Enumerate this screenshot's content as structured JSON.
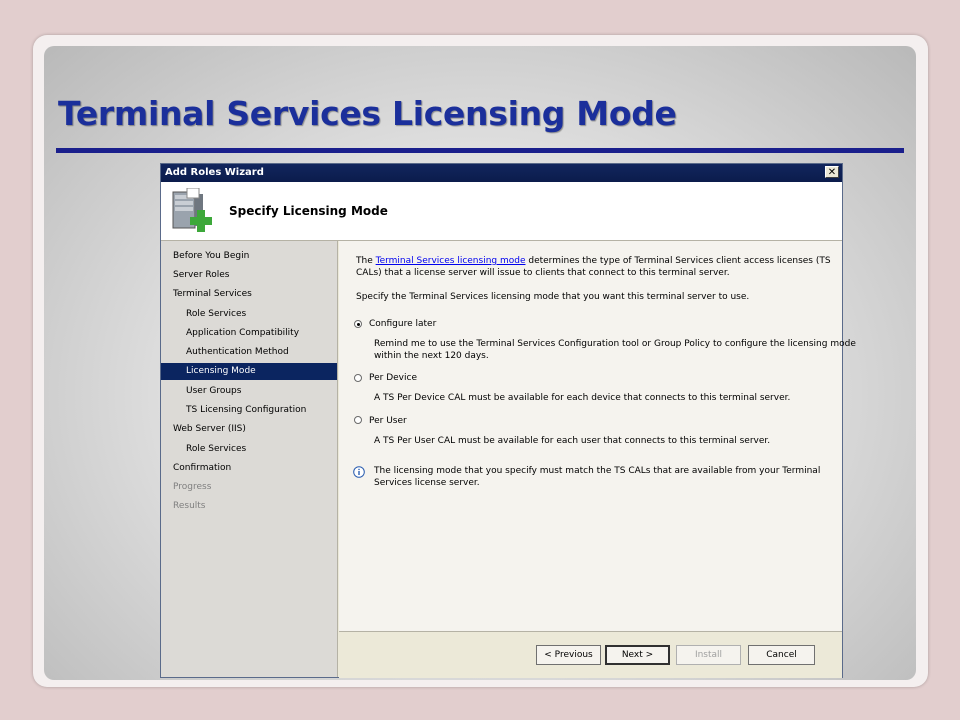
{
  "slide": {
    "title": "Terminal Services Licensing Mode"
  },
  "wizard": {
    "window_title": "Add Roles Wizard",
    "close_glyph": "✕",
    "page_heading": "Specify Licensing Mode",
    "icon": "server-add-icon",
    "nav": [
      {
        "label": "Before You Begin",
        "state": "normal"
      },
      {
        "label": "Server Roles",
        "state": "normal"
      },
      {
        "label": "Terminal Services",
        "state": "normal"
      },
      {
        "label": "Role Services",
        "state": "normal"
      },
      {
        "label": "Application Compatibility",
        "state": "normal"
      },
      {
        "label": "Authentication Method",
        "state": "normal"
      },
      {
        "label": "Licensing Mode",
        "state": "active"
      },
      {
        "label": "User Groups",
        "state": "normal"
      },
      {
        "label": "TS Licensing Configuration",
        "state": "normal"
      },
      {
        "label": "Web Server (IIS)",
        "state": "normal"
      },
      {
        "label": "Role Services",
        "state": "normal"
      },
      {
        "label": "Confirmation",
        "state": "normal"
      },
      {
        "label": "Progress",
        "state": "disabled"
      },
      {
        "label": "Results",
        "state": "disabled"
      }
    ],
    "intro": {
      "prefix": "The ",
      "link": "Terminal Services licensing mode",
      "suffix_line1": " determines the type of Terminal Services client access licenses (TS",
      "line2": "CALs) that a license server will issue to clients that connect to this terminal server."
    },
    "instruction": "Specify the Terminal Services licensing mode that you want this terminal server to use.",
    "options": [
      {
        "label": "Configure later",
        "checked": true,
        "desc1": "Remind me to use the Terminal Services Configuration tool or Group Policy to configure the licensing mode",
        "desc2": "within the next 120 days."
      },
      {
        "label": "Per Device",
        "checked": false,
        "desc1": "A TS Per Device CAL must be available for each device that connects to this terminal server.",
        "desc2": ""
      },
      {
        "label": "Per User",
        "checked": false,
        "desc1": "A TS Per User CAL must be available for each user that connects to this terminal server.",
        "desc2": ""
      }
    ],
    "note": {
      "icon": "info-icon",
      "line1": "The licensing mode that you specify must match the TS CALs that are available from your Terminal",
      "line2": "Services license server."
    },
    "buttons": {
      "previous": "< Previous",
      "next": "Next >",
      "install": "Install",
      "cancel": "Cancel"
    }
  },
  "colors": {
    "title_blue": "#1b2f9b",
    "rule_navy": "#1a1f8c",
    "nav_active": "#0b2560",
    "link": "#0000ee"
  }
}
